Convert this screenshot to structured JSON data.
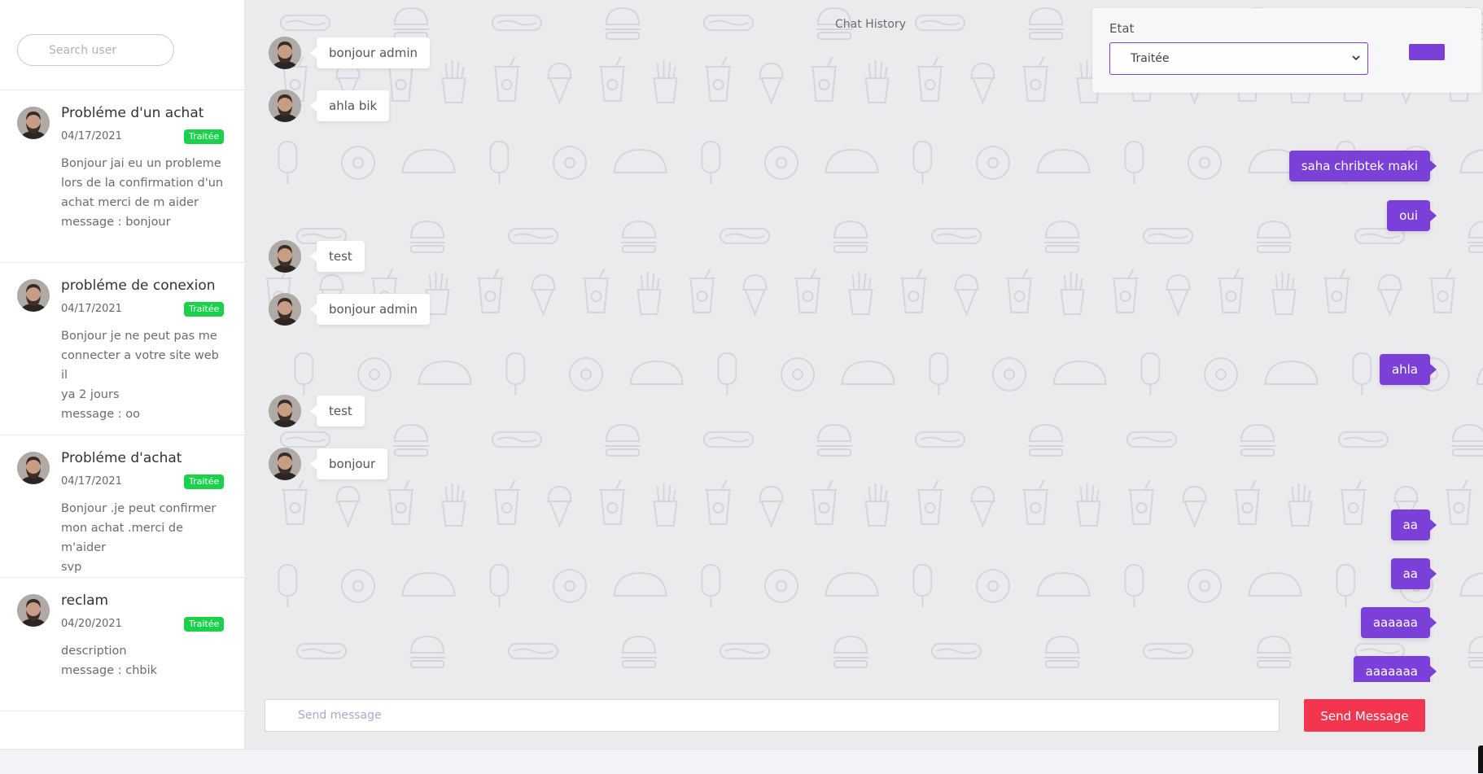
{
  "sidebar": {
    "search_placeholder": "Search user",
    "tickets": [
      {
        "title": "Probléme d'un achat",
        "date": "04/17/2021",
        "status": "Traitée",
        "desc_lines": [
          "Bonjour jai eu un probleme",
          "lors de la confirmation d'un",
          "achat merci de m aider",
          "message : bonjour"
        ]
      },
      {
        "title": "probléme de conexion",
        "date": "04/17/2021",
        "status": "Traitée",
        "desc_lines": [
          "Bonjour je ne peut pas me",
          "connecter a votre site web il",
          "ya 2 jours",
          "message : oo"
        ]
      },
      {
        "title": "Probléme d'achat",
        "date": "04/17/2021",
        "status": "Traitée",
        "desc_lines": [
          "Bonjour .je peut confirmer",
          "mon achat .merci de m'aider",
          "svp"
        ]
      },
      {
        "title": "reclam",
        "date": "04/20/2021",
        "status": "Traitée",
        "desc_lines": [
          "description",
          "message : chbik"
        ]
      }
    ]
  },
  "chat": {
    "title": "Chat History",
    "messages": [
      {
        "dir": "in",
        "text": "bonjour admin"
      },
      {
        "dir": "in",
        "text": "ahla bik"
      },
      {
        "dir": "out",
        "text": "saha chribtek maki"
      },
      {
        "dir": "out",
        "text": "oui"
      },
      {
        "dir": "in",
        "text": "test"
      },
      {
        "dir": "in",
        "text": "bonjour admin"
      },
      {
        "dir": "out",
        "text": "ahla"
      },
      {
        "dir": "in",
        "text": "test"
      },
      {
        "dir": "in",
        "text": "bonjour"
      },
      {
        "dir": "out",
        "text": "aa"
      },
      {
        "dir": "out",
        "text": "aa"
      },
      {
        "dir": "out",
        "text": "aaaaaa"
      },
      {
        "dir": "out",
        "text": "aaaaaaa"
      }
    ],
    "composer_placeholder": "Send message",
    "send_label": "Send Message"
  },
  "etat": {
    "label": "Etat",
    "selected": "Traitée"
  },
  "colors": {
    "accent": "#7a40d8",
    "status_green": "#19d14a",
    "send_red": "#f4354f"
  }
}
